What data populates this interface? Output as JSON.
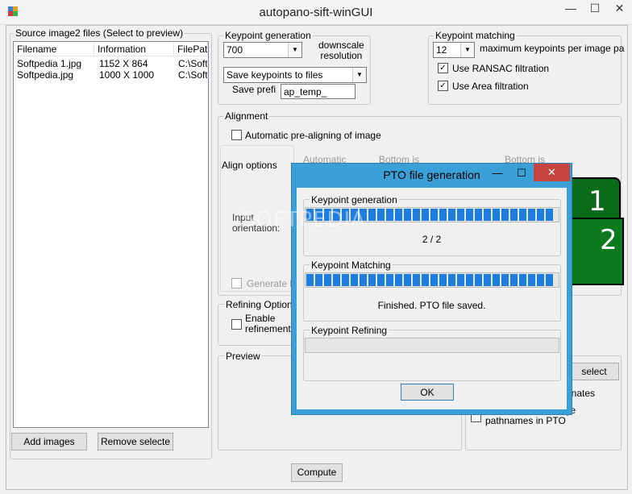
{
  "window": {
    "title": "autopano-sift-winGUI",
    "minimize": "—",
    "maximize": "☐",
    "close": "✕"
  },
  "source": {
    "legend": "Source image2   files (Select to preview)",
    "columns": [
      "Filename",
      "Information",
      "FilePath"
    ],
    "rows": [
      [
        "Softpedia 1.jpg",
        "1152 X 864",
        "C:\\Soft"
      ],
      [
        "Softpedia.jpg",
        "1000 X 1000",
        "C:\\Soft"
      ]
    ],
    "add_button": "Add images",
    "remove_button": "Remove selecte"
  },
  "keypoint_generation": {
    "legend": "Keypoint generation",
    "resolution_value": "700",
    "downscale_label": "downscale\nresolution",
    "save_option": "Save keypoints to files",
    "save_prefix_label": "Save prefi",
    "save_prefix_value": "ap_temp_"
  },
  "keypoint_matching": {
    "legend": "Keypoint matching",
    "max_value": "12",
    "max_label": "maximum keypoints per image pa",
    "ransac_label": "Use RANSAC filtration",
    "area_label": "Use Area filtration"
  },
  "alignment": {
    "legend": "Alignment",
    "auto_prealign_label": "Automatic pre-aligning of image",
    "align_options_label": "Align options",
    "opt_automatic": "Automatic",
    "opt_bottom1": "Bottom is",
    "opt_bottom2": "Bottom is",
    "input_orientation": "Input\norientation:",
    "generate_label": "Generate h"
  },
  "refining": {
    "legend": "Refining Options",
    "enable_label": "Enable\nrefinement s"
  },
  "preview": {
    "legend": "Preview"
  },
  "output": {
    "select_button": "select",
    "coords_label": "inates",
    "save_abs_label": "Save absolute image\npathnames in PTO"
  },
  "compute_button": "Compute",
  "dialog": {
    "title": "PTO file generation",
    "kg_legend": "Keypoint generation",
    "kg_status": "2 / 2",
    "kg_progress": 1.0,
    "km_legend": "Keypoint Matching",
    "km_status": "Finished. PTO file saved.",
    "km_progress": 1.0,
    "kr_legend": "Keypoint Refining",
    "kr_progress": 0.0,
    "ok_button": "OK",
    "minimize": "—",
    "maximize": "☐",
    "close": "✕"
  },
  "preview_image": {
    "label1": "1",
    "label2": "2"
  },
  "watermark": "SOFTPEDIA"
}
